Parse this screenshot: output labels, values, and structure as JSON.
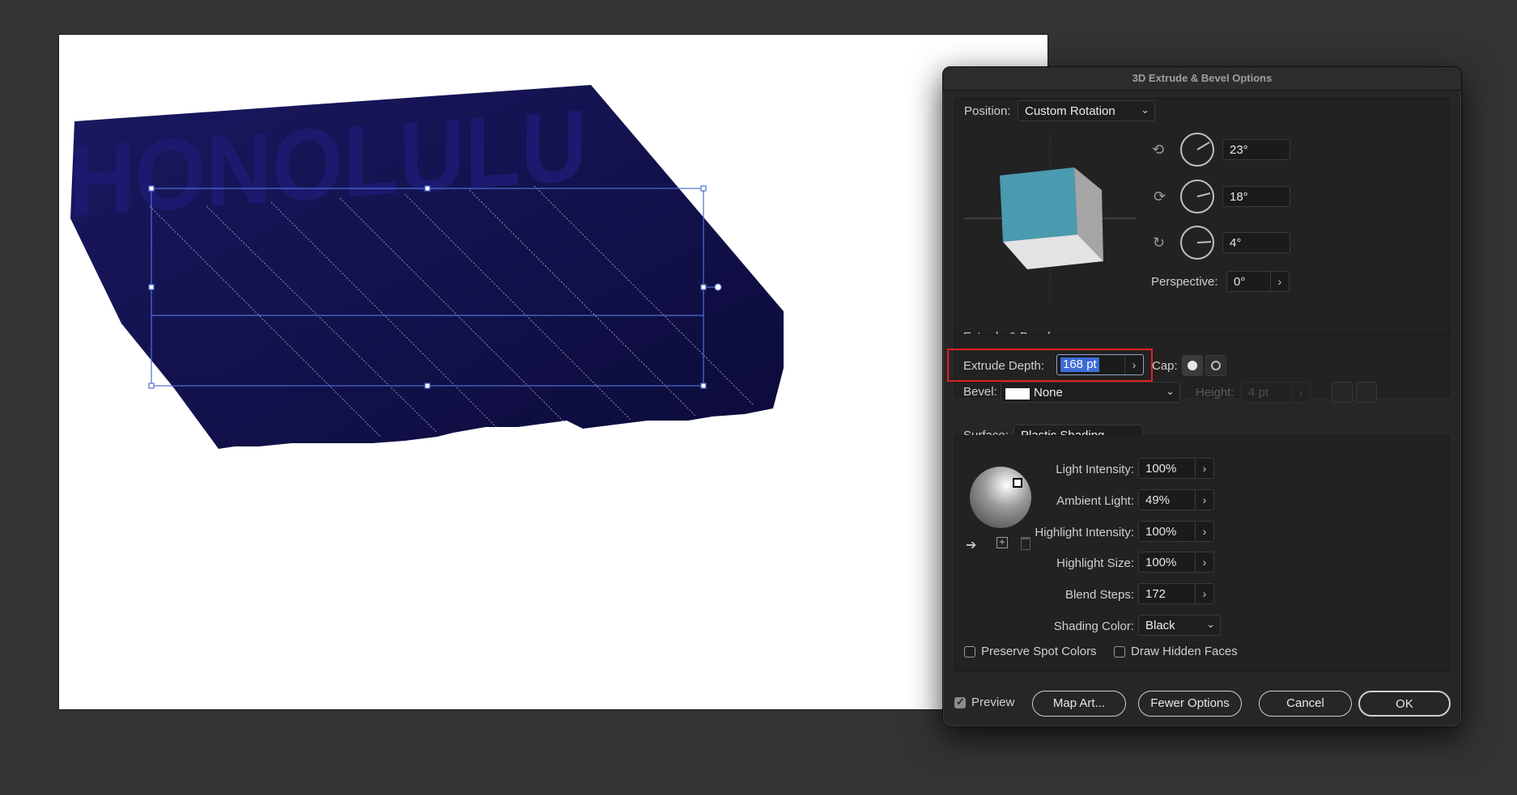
{
  "artwork": {
    "text": "HONOLULU",
    "color": "#12104f"
  },
  "dialog": {
    "title": "3D Extrude & Bevel Options",
    "position": {
      "label": "Position:",
      "value": "Custom Rotation",
      "x_angle": "23°",
      "y_angle": "18°",
      "z_angle": "4°",
      "perspective_label": "Perspective:",
      "perspective_value": "0°"
    },
    "extrude": {
      "section_title": "Extrude & Bevel",
      "depth_label": "Extrude Depth:",
      "depth_value": "168 pt",
      "cap_label": "Cap:",
      "bevel_label": "Bevel:",
      "bevel_value": "None",
      "height_label": "Height:",
      "height_value": "4 pt"
    },
    "surface": {
      "label": "Surface:",
      "value": "Plastic Shading",
      "light_intensity_label": "Light Intensity:",
      "light_intensity": "100%",
      "ambient_light_label": "Ambient Light:",
      "ambient_light": "49%",
      "highlight_intensity_label": "Highlight Intensity:",
      "highlight_intensity": "100%",
      "highlight_size_label": "Highlight Size:",
      "highlight_size": "100%",
      "blend_steps_label": "Blend Steps:",
      "blend_steps": "172",
      "shading_color_label": "Shading Color:",
      "shading_color": "Black",
      "preserve_spot_colors": "Preserve Spot Colors",
      "draw_hidden_faces": "Draw Hidden Faces"
    },
    "footer": {
      "preview": "Preview",
      "map_art": "Map Art...",
      "fewer_options": "Fewer Options",
      "cancel": "Cancel",
      "ok": "OK"
    }
  },
  "colors": {
    "accent_red": "#e02020",
    "selection_blue": "#3d6bd6",
    "cube_face": "#4a9ab0"
  }
}
